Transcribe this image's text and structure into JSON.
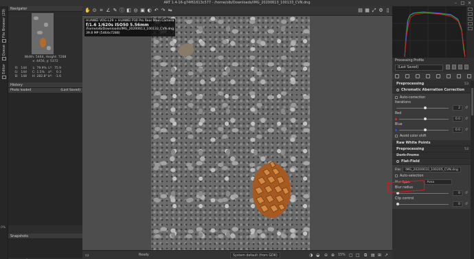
{
  "window": {
    "title": "ART 1.4-16-g74f61613c577 - /home/olb/Downloads/IMG_20200613_100133_CVN.dng"
  },
  "vertical_tabs": [
    "File Browser (29)",
    "Queue",
    "Editor"
  ],
  "zoom_side": "0%",
  "navigator": {
    "title": "Navigator",
    "size_text": "Width: 5464, Height: 7288",
    "coords_text": "x: 4456, y: 5372",
    "rows": [
      [
        "R:",
        "144",
        "L:",
        "79.9%",
        "L*:",
        "75.9"
      ],
      [
        "G:",
        "144",
        "C:",
        "1.5%",
        "a*:",
        "0.3"
      ],
      [
        "B:",
        "148",
        "H:",
        "282.8°",
        "b*:",
        "-1.6"
      ]
    ]
  },
  "history": {
    "title": "History",
    "items": [
      {
        "label": "Photo loaded",
        "value": "(Last Saved)"
      }
    ]
  },
  "snapshots": {
    "title": "Snapshots",
    "add_label": "+",
    "remove_label": "−"
  },
  "photo": {
    "overlay_line1": "HUAWEI VOG-L29 + HUAWEI P30 Pro Rear Main Camera",
    "overlay_line2": "f/1.6  1/620s  ISO50  5.56mm",
    "overlay_line3": "/home/olb/Downloads/IMG_20200613_100133_CVN.dng",
    "overlay_line4": "39.8 MP (5464x7288)"
  },
  "status": {
    "ready": "Ready",
    "profile": "System default (from GDK)",
    "zoom": "15%"
  },
  "processing_profile": {
    "label": "Processing Profile",
    "selected": "(Last Saved)"
  },
  "tools": {
    "preprocessing_title": "Preprocessing",
    "preprocessing_num": "53",
    "ca_title": "Chromatic Aberration Correction",
    "auto_correction": "Auto-correction",
    "iterations_label": "Iterations",
    "iterations_value": "2",
    "red_label": "Red",
    "red_value": "0.0",
    "blue_label": "Blue",
    "blue_value": "0.0",
    "avoid_color_shift": "Avoid color shift",
    "raw_white_points": "Raw White Points",
    "preprocessing2": "Preprocessing",
    "dark_frame": "Dark-Frame",
    "flat_field": "Flat-Field",
    "file_label": "File:",
    "file_value": "IMG_20200610_100205_CVN.dng",
    "auto_selection": "Auto-selection",
    "blur_type_label": "Blur type:",
    "blur_type_value": "Area",
    "blur_radius_label": "Blur radius",
    "blur_radius_value": "0",
    "clip_control_label": "Clip control",
    "clip_control_value": "0"
  },
  "annotation_color": "#e01818"
}
